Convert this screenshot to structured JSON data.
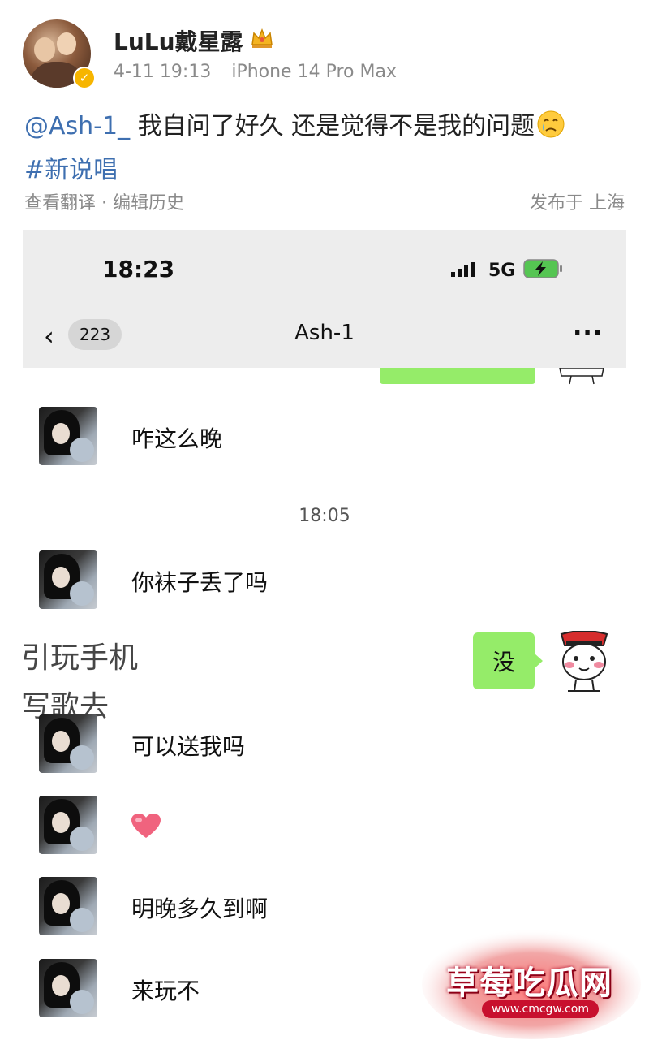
{
  "post": {
    "username": "LuLu戴星露",
    "date": "4-11 19:13",
    "device": "iPhone 14 Pro Max",
    "mention": "@Ash-1_",
    "text": " 我自问了好久 还是觉得不是我的问题",
    "hashtag": "#新说唱",
    "actions": "查看翻译 · 编辑历史",
    "location": "发布于 上海"
  },
  "chat_screenshot": {
    "status_time": "18:23",
    "network": "5G",
    "unread_count": "223",
    "chat_title": "Ash-1",
    "more": "···",
    "timestamp": "18:05",
    "messages": [
      {
        "from": "other",
        "text": "咋这么晚"
      },
      {
        "from": "other",
        "text": "你袜子丢了吗"
      },
      {
        "from": "me",
        "text": "没"
      },
      {
        "from": "other",
        "text": "可以送我吗"
      },
      {
        "from": "other",
        "emoji": "heart"
      },
      {
        "from": "other",
        "text": "明晚多久到啊"
      },
      {
        "from": "other",
        "text": "来玩不"
      }
    ],
    "overlay_lines": [
      "引玩手机",
      "写歌去"
    ]
  },
  "watermark": {
    "title": "草莓吃瓜网",
    "url": "www.cmcgw.com"
  },
  "colors": {
    "link": "#3e6fb0",
    "bubble_green": "#95ec69",
    "verified": "#f7b500"
  }
}
